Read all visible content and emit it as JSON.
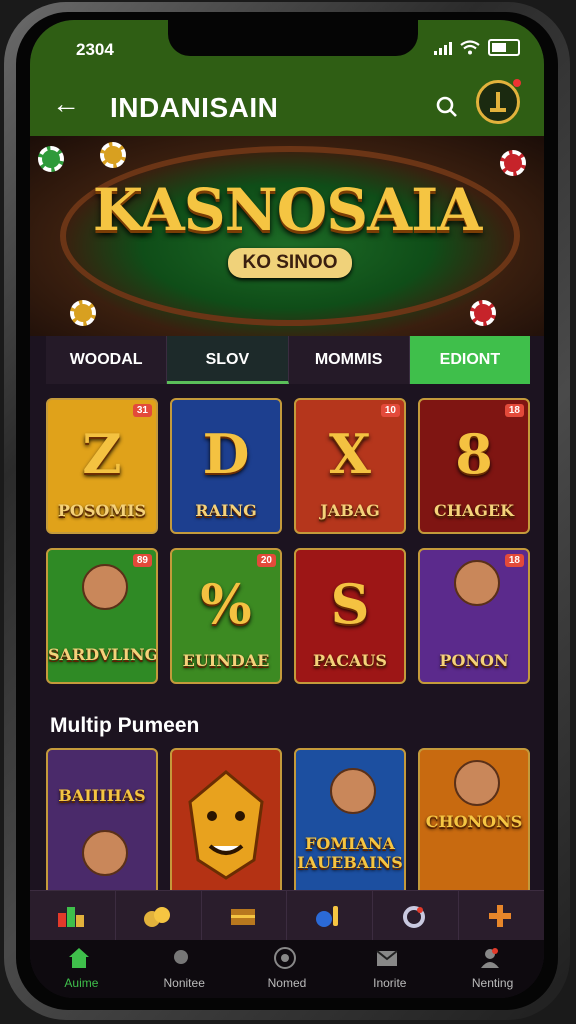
{
  "status": {
    "time": "2304"
  },
  "header": {
    "title": "INDANISAIN"
  },
  "hero": {
    "title": "KASNOSAIA",
    "subtitle": "KO SINOO"
  },
  "tabs": [
    {
      "label": "WOODAL"
    },
    {
      "label": "SLOV"
    },
    {
      "label": "MOMMIS"
    },
    {
      "label": "EDIONT"
    }
  ],
  "games": [
    {
      "glyph": "Z",
      "name": "POSOMIS",
      "badge": "31",
      "bg": "#e0a21a"
    },
    {
      "glyph": "D",
      "name": "RAING",
      "badge": "",
      "bg": "#1d3f8f"
    },
    {
      "glyph": "X",
      "name": "JABAG",
      "badge": "10",
      "bg": "#b5361c"
    },
    {
      "glyph": "8",
      "name": "CHAGEK",
      "badge": "18",
      "bg": "#7f1512"
    },
    {
      "glyph": "",
      "name": "SARDVLING",
      "badge": "89",
      "bg": "#2f8a25"
    },
    {
      "glyph": "%",
      "name": "EUINDAE",
      "badge": "20",
      "bg": "#3c8a22"
    },
    {
      "glyph": "S",
      "name": "PACAUS",
      "badge": "",
      "bg": "#9d1616"
    },
    {
      "glyph": "",
      "name": "PONON",
      "badge": "18",
      "bg": "#5b2a8c"
    }
  ],
  "sections": {
    "multi_title": "Multip Pumeen"
  },
  "multi_games": [
    {
      "name": "BAIIIHAS",
      "bg": "#4a2a6a"
    },
    {
      "name": "",
      "bg": "#b43214"
    },
    {
      "name": "FOMIANA IAUEBAINS",
      "bg": "#1c4fa0"
    },
    {
      "name": "CHONONS",
      "bg": "#c86a10"
    }
  ],
  "bottom_nav": [
    {
      "label": "Auime"
    },
    {
      "label": "Nonitee"
    },
    {
      "label": "Nomed"
    },
    {
      "label": "Inorite"
    },
    {
      "label": "Nenting"
    }
  ],
  "colors": {
    "brand_green": "#2f5e14",
    "accent_gold": "#f5c542",
    "cta_green": "#3fbf4b"
  }
}
